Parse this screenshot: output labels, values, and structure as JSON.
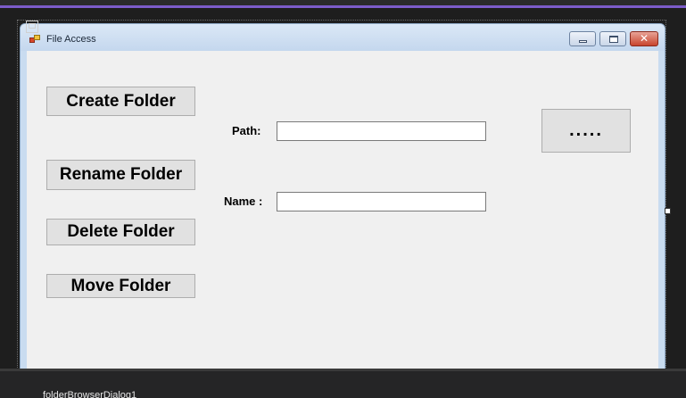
{
  "window": {
    "title": "File Access"
  },
  "buttons": {
    "create_folder": "Create Folder",
    "rename_folder": "Rename Folder",
    "delete_folder": "Delete Folder",
    "move_folder": "Move Folder",
    "browse": "....."
  },
  "labels": {
    "path": "Path:",
    "name": "Name :"
  },
  "inputs": {
    "path_value": "",
    "name_value": ""
  },
  "component_tray": {
    "item_label": "folderBrowserDialog1",
    "item_icon": "dialog-component-icon"
  },
  "colors": {
    "accent": "#7c5cc9",
    "form_background": "#f0f0f0",
    "designer_background": "#1e1e1e",
    "button_face": "#e1e1e1"
  }
}
